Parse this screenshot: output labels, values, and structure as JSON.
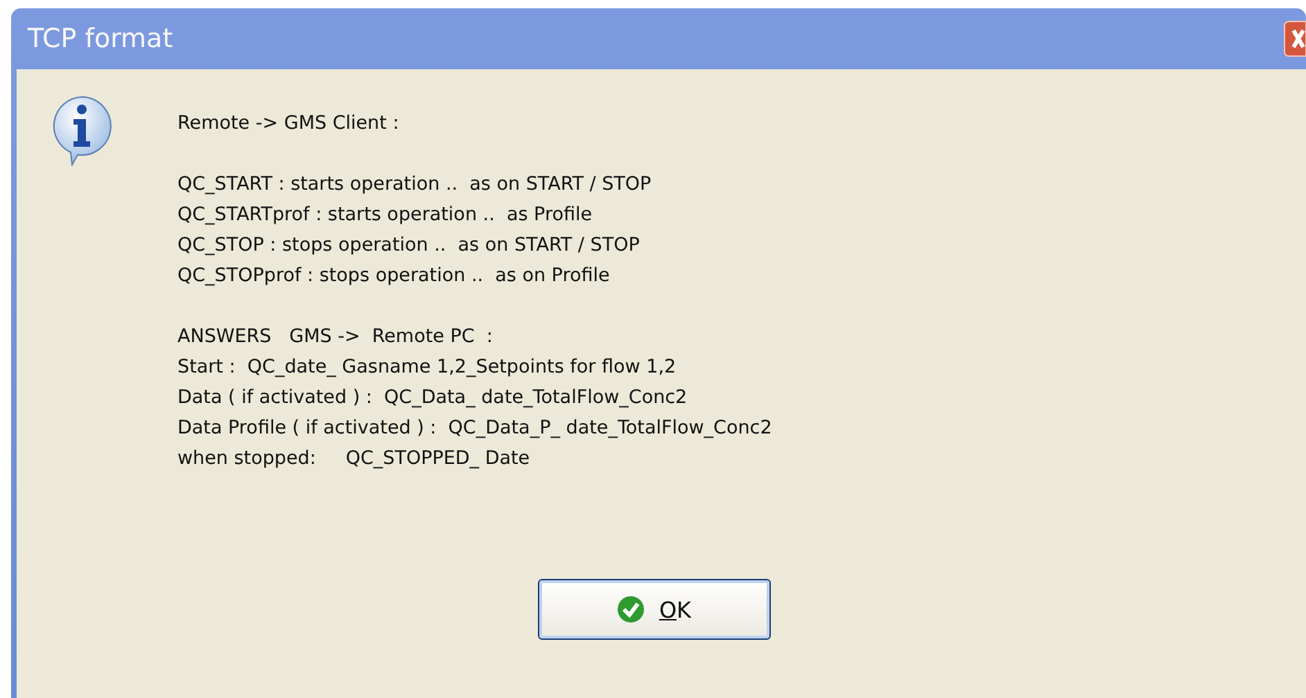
{
  "window": {
    "title": "TCP format"
  },
  "message_groups": [
    [
      "Remote -> GMS Client :"
    ],
    [
      "QC_START : starts operation ..  as on START / STOP",
      "QC_STARTprof : starts operation ..  as Profile",
      "QC_STOP : stops operation ..  as on START / STOP",
      "QC_STOPprof : stops operation ..  as on Profile"
    ],
    [
      "ANSWERS   GMS ->  Remote PC  :",
      "Start :  QC_date_ Gasname 1,2_Setpoints for flow 1,2",
      "Data ( if activated ) :  QC_Data_ date_TotalFlow_Conc2",
      "Data Profile ( if activated ) :  QC_Data_P_ date_TotalFlow_Conc2",
      "when stopped:     QC_STOPPED_ Date"
    ]
  ],
  "buttons": [
    {
      "label": "OK"
    }
  ]
}
